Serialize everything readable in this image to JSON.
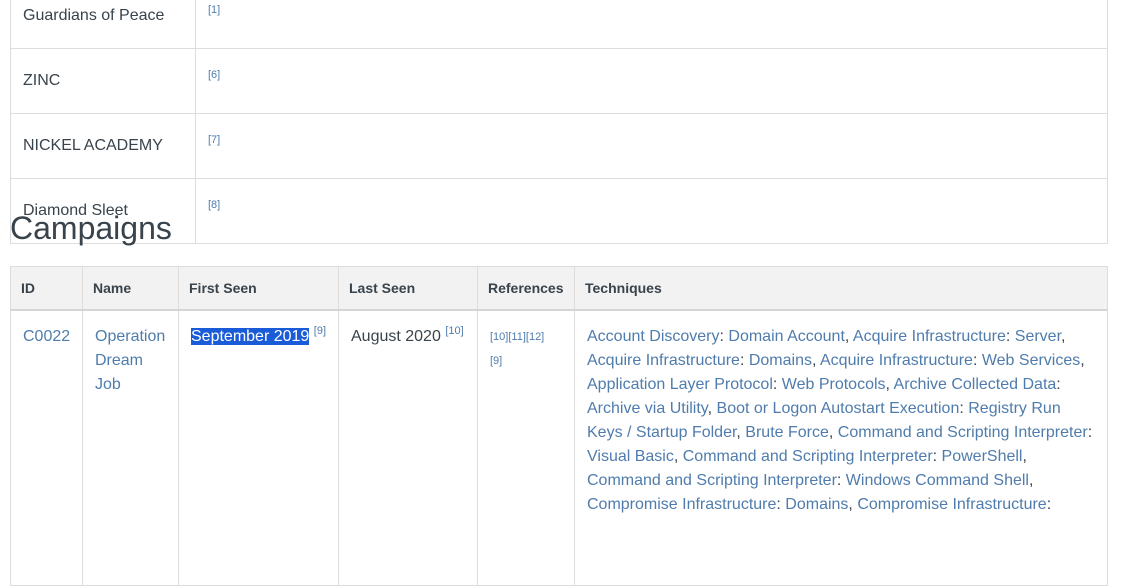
{
  "groups": [
    {
      "name": "Guardians of Peace",
      "ref": "[1]"
    },
    {
      "name": "ZINC",
      "ref": "[6]"
    },
    {
      "name": "NICKEL ACADEMY",
      "ref": "[7]"
    },
    {
      "name": "Diamond Sleet",
      "ref": "[8]"
    }
  ],
  "campaigns_section": {
    "title": "Campaigns",
    "headers": {
      "id": "ID",
      "name": "Name",
      "first_seen": "First Seen",
      "last_seen": "Last Seen",
      "references": "References",
      "techniques": "Techniques"
    },
    "rows": [
      {
        "id": "C0022",
        "name": "Operation Dream Job",
        "first_seen": "September 2019",
        "first_seen_ref": "[9]",
        "last_seen": "August 2020",
        "last_seen_ref": "[10]",
        "refs": [
          "[10]",
          "[11]",
          "[12]",
          "[9]"
        ],
        "techniques": [
          {
            "parent": "Account Discovery",
            "sub": "Domain Account"
          },
          {
            "parent": "Acquire Infrastructure",
            "sub": "Server"
          },
          {
            "parent": "Acquire Infrastructure",
            "sub": "Domains"
          },
          {
            "parent": "Acquire Infrastructure",
            "sub": "Web Services"
          },
          {
            "parent": "Application Layer Protocol",
            "sub": "Web Protocols"
          },
          {
            "parent": "Archive Collected Data",
            "sub": "Archive via Utility"
          },
          {
            "parent": "Boot or Logon Autostart Execution",
            "sub": "Registry Run Keys / Startup Folder"
          },
          {
            "parent": "Brute Force",
            "sub": null
          },
          {
            "parent": "Command and Scripting Interpreter",
            "sub": "Visual Basic"
          },
          {
            "parent": "Command and Scripting Interpreter",
            "sub": "PowerShell"
          },
          {
            "parent": "Command and Scripting Interpreter",
            "sub": "Windows Command Shell"
          },
          {
            "parent": "Compromise Infrastructure",
            "sub": "Domains"
          },
          {
            "parent": "Compromise Infrastructure",
            "sub": ""
          }
        ]
      }
    ]
  },
  "colors": {
    "link": "#4f7cac",
    "text": "#39434c",
    "header_bg": "#f2f2f2",
    "border": "#dddddd",
    "selection": "#1a5bd8"
  }
}
